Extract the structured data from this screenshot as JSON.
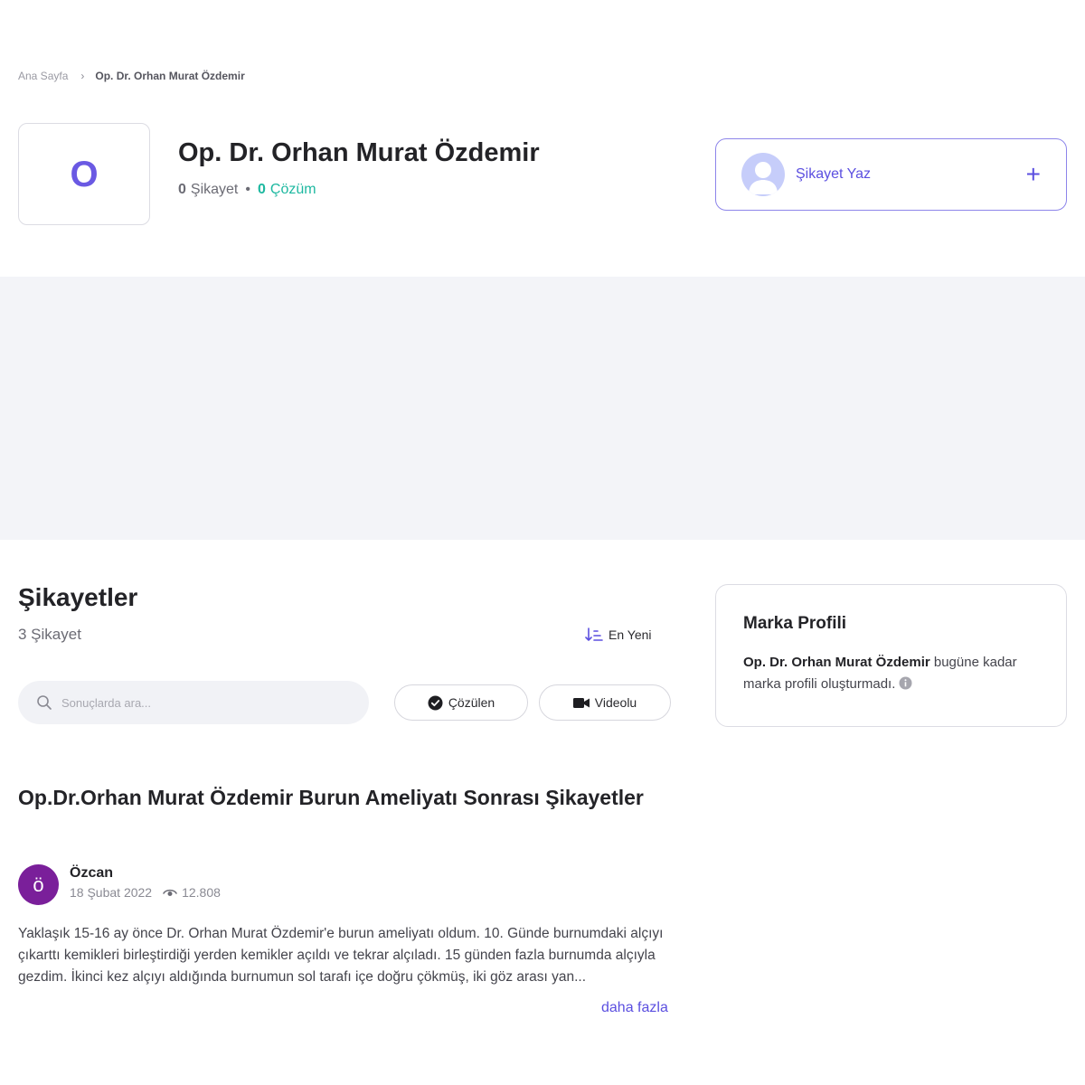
{
  "breadcrumb": {
    "home": "Ana Sayfa",
    "separator": "›",
    "current": "Op. Dr. Orhan Murat Özdemir"
  },
  "brand": {
    "logo_letter": "O",
    "name": "Op. Dr. Orhan Murat Özdemir",
    "complaint_count": "0",
    "complaint_label": "Şikayet",
    "dot": "•",
    "solution_count": "0",
    "solution_label": "Çözüm"
  },
  "write_complaint": {
    "label": "Şikayet Yaz",
    "plus": "+"
  },
  "complaints": {
    "title": "Şikayetler",
    "count_text": "3 Şikayet",
    "sort_label": "En Yeni",
    "search_placeholder": "Sonuçlarda ara...",
    "filters": {
      "solved": "Çözülen",
      "video": "Videolu"
    }
  },
  "sidebar": {
    "title": "Marka Profili",
    "brand_name": "Op. Dr. Orhan Murat Özdemir",
    "text_rest": "bugüne kadar marka profili oluşturmadı."
  },
  "complaint_item": {
    "title": "Op.Dr.Orhan Murat Özdemir Burun Ameliyatı Sonrası Şikayetler",
    "user_initial": "ö",
    "user_name": "Özcan",
    "date": "18 Şubat 2022",
    "views": "12.808",
    "body": "Yaklaşık 15-16 ay önce Dr. Orhan Murat Özdemir'e burun ameliyatı oldum. 10. Günde burnumdaki alçıyı çıkarttı kemikleri birleştirdiği yerden kemikler açıldı ve tekrar alçıladı. 15 günden fazla burnumda alçıyla gezdim. İkinci kez alçıyı aldığında burnumun sol tarafı içe doğru çökmüş, iki göz arası yan...",
    "more_label": "daha fazla"
  },
  "colors": {
    "accent": "#5b4fe0",
    "solved": "#1db8a0",
    "user_avatar": "#7a1f9a",
    "ad_background": "#f3f4f8"
  },
  "icons": {
    "breadcrumb_separator": "chevron-right-icon",
    "write_avatar": "user-silhouette-icon",
    "plus": "plus-icon",
    "sort": "sort-descending-icon",
    "search": "search-icon",
    "solved": "check-circle-icon",
    "video": "video-camera-icon",
    "views": "eye-icon",
    "info": "info-icon"
  }
}
